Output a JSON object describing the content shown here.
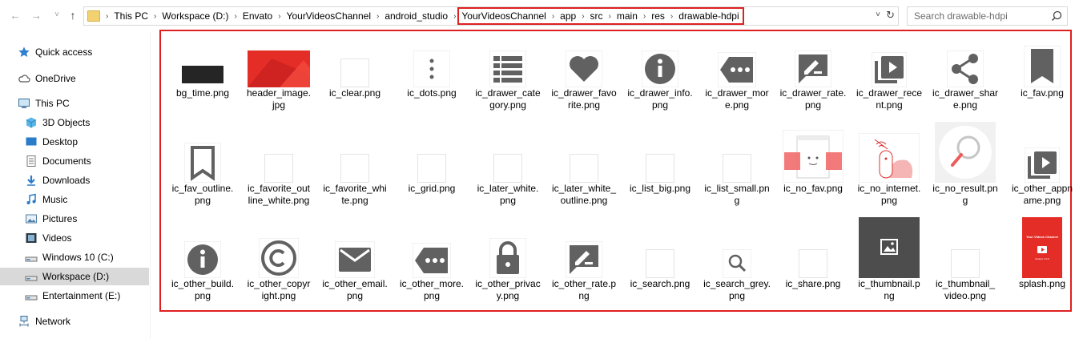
{
  "nav": {
    "back": "←",
    "forward": "→",
    "recent": "˅",
    "up": "↑"
  },
  "address": {
    "crumbs_left": [
      "This PC",
      "Workspace (D:)",
      "Envato",
      "YourVideosChannel",
      "android_studio"
    ],
    "crumbs_highlighted": [
      "YourVideosChannel",
      "app",
      "src",
      "main",
      "res",
      "drawable-hdpi"
    ],
    "separator": "›",
    "dropdown": "˅",
    "refresh": "↻"
  },
  "search": {
    "placeholder": "Search drawable-hdpi"
  },
  "sidebar": {
    "items": [
      {
        "label": "Quick access",
        "icon": "star-icon"
      },
      {
        "label": "OneDrive",
        "icon": "cloud-icon"
      },
      {
        "label": "This PC",
        "icon": "computer-icon"
      },
      {
        "label": "3D Objects",
        "icon": "cube-icon"
      },
      {
        "label": "Desktop",
        "icon": "desktop-icon"
      },
      {
        "label": "Documents",
        "icon": "documents-icon"
      },
      {
        "label": "Downloads",
        "icon": "download-icon"
      },
      {
        "label": "Music",
        "icon": "music-icon"
      },
      {
        "label": "Pictures",
        "icon": "pictures-icon"
      },
      {
        "label": "Videos",
        "icon": "videos-icon"
      },
      {
        "label": "Windows 10 (C:)",
        "icon": "drive-icon"
      },
      {
        "label": "Workspace (D:)",
        "icon": "drive-icon"
      },
      {
        "label": "Entertainment (E:)",
        "icon": "drive-icon"
      },
      {
        "label": "Network",
        "icon": "network-icon"
      }
    ]
  },
  "files": [
    {
      "line1": "bg_time.png",
      "line2": "",
      "icon": "dark-bar-image"
    },
    {
      "line1": "header_image.",
      "line2": "jpg",
      "icon": "red-header-image"
    },
    {
      "line1": "ic_clear.png",
      "line2": "",
      "icon": "blank-image"
    },
    {
      "line1": "ic_dots.png",
      "line2": "",
      "icon": "dots-icon"
    },
    {
      "line1": "ic_drawer_cate",
      "line2": "gory.png",
      "icon": "list-icon"
    },
    {
      "line1": "ic_drawer_favo",
      "line2": "rite.png",
      "icon": "heart-icon"
    },
    {
      "line1": "ic_drawer_info.",
      "line2": "png",
      "icon": "info-icon"
    },
    {
      "line1": "ic_drawer_mor",
      "line2": "e.png",
      "icon": "more-tag-icon"
    },
    {
      "line1": "ic_drawer_rate.",
      "line2": "png",
      "icon": "rate-icon"
    },
    {
      "line1": "ic_drawer_rece",
      "line2": "nt.png",
      "icon": "recent-play-icon"
    },
    {
      "line1": "ic_drawer_shar",
      "line2": "e.png",
      "icon": "share-icon"
    },
    {
      "line1": "ic_fav.png",
      "line2": "",
      "icon": "bookmark-icon"
    },
    {
      "line1": "ic_fav_outline.",
      "line2": "png",
      "icon": "bookmark-outline-icon"
    },
    {
      "line1": "ic_favorite_out",
      "line2": "line_white.png",
      "icon": "blank-image"
    },
    {
      "line1": "ic_favorite_whi",
      "line2": "te.png",
      "icon": "blank-image"
    },
    {
      "line1": "ic_grid.png",
      "line2": "",
      "icon": "blank-image"
    },
    {
      "line1": "ic_later_white.",
      "line2": "png",
      "icon": "blank-image"
    },
    {
      "line1": "ic_later_white_",
      "line2": "outline.png",
      "icon": "blank-image"
    },
    {
      "line1": "ic_list_big.png",
      "line2": "",
      "icon": "blank-image"
    },
    {
      "line1": "ic_list_small.pn",
      "line2": "g",
      "icon": "blank-image"
    },
    {
      "line1": "ic_no_fav.png",
      "line2": "",
      "icon": "no-fav-illustration"
    },
    {
      "line1": "ic_no_internet.",
      "line2": "png",
      "icon": "no-internet-illustration"
    },
    {
      "line1": "ic_no_result.pn",
      "line2": "g",
      "icon": "no-result-illustration"
    },
    {
      "line1": "ic_other_appn",
      "line2": "ame.png",
      "icon": "recent-play-icon"
    },
    {
      "line1": "ic_other_build.",
      "line2": "png",
      "icon": "info-icon"
    },
    {
      "line1": "ic_other_copyr",
      "line2": "ight.png",
      "icon": "copyright-icon"
    },
    {
      "line1": "ic_other_email.",
      "line2": "png",
      "icon": "email-icon"
    },
    {
      "line1": "ic_other_more.",
      "line2": "png",
      "icon": "more-tag-icon"
    },
    {
      "line1": "ic_other_privac",
      "line2": "y.png",
      "icon": "lock-icon"
    },
    {
      "line1": "ic_other_rate.p",
      "line2": "ng",
      "icon": "rate-icon"
    },
    {
      "line1": "ic_search.png",
      "line2": "",
      "icon": "blank-image"
    },
    {
      "line1": "ic_search_grey.",
      "line2": "png",
      "icon": "search-small-icon"
    },
    {
      "line1": "ic_share.png",
      "line2": "",
      "icon": "blank-image"
    },
    {
      "line1": "ic_thumbnail.p",
      "line2": "ng",
      "icon": "thumbnail-image-icon"
    },
    {
      "line1": "ic_thumbnail_",
      "line2": "video.png",
      "icon": "blank-image"
    },
    {
      "line1": "splash.png",
      "line2": "",
      "icon": "splash-image"
    }
  ],
  "splash_text": {
    "title": "Your Videos Channel",
    "version": "Version 1.0.0"
  },
  "colors": {
    "highlight": "#e02020",
    "icon_grey": "#616161",
    "brand_red": "#e52d27",
    "selected_bg": "#d9d9d9"
  }
}
